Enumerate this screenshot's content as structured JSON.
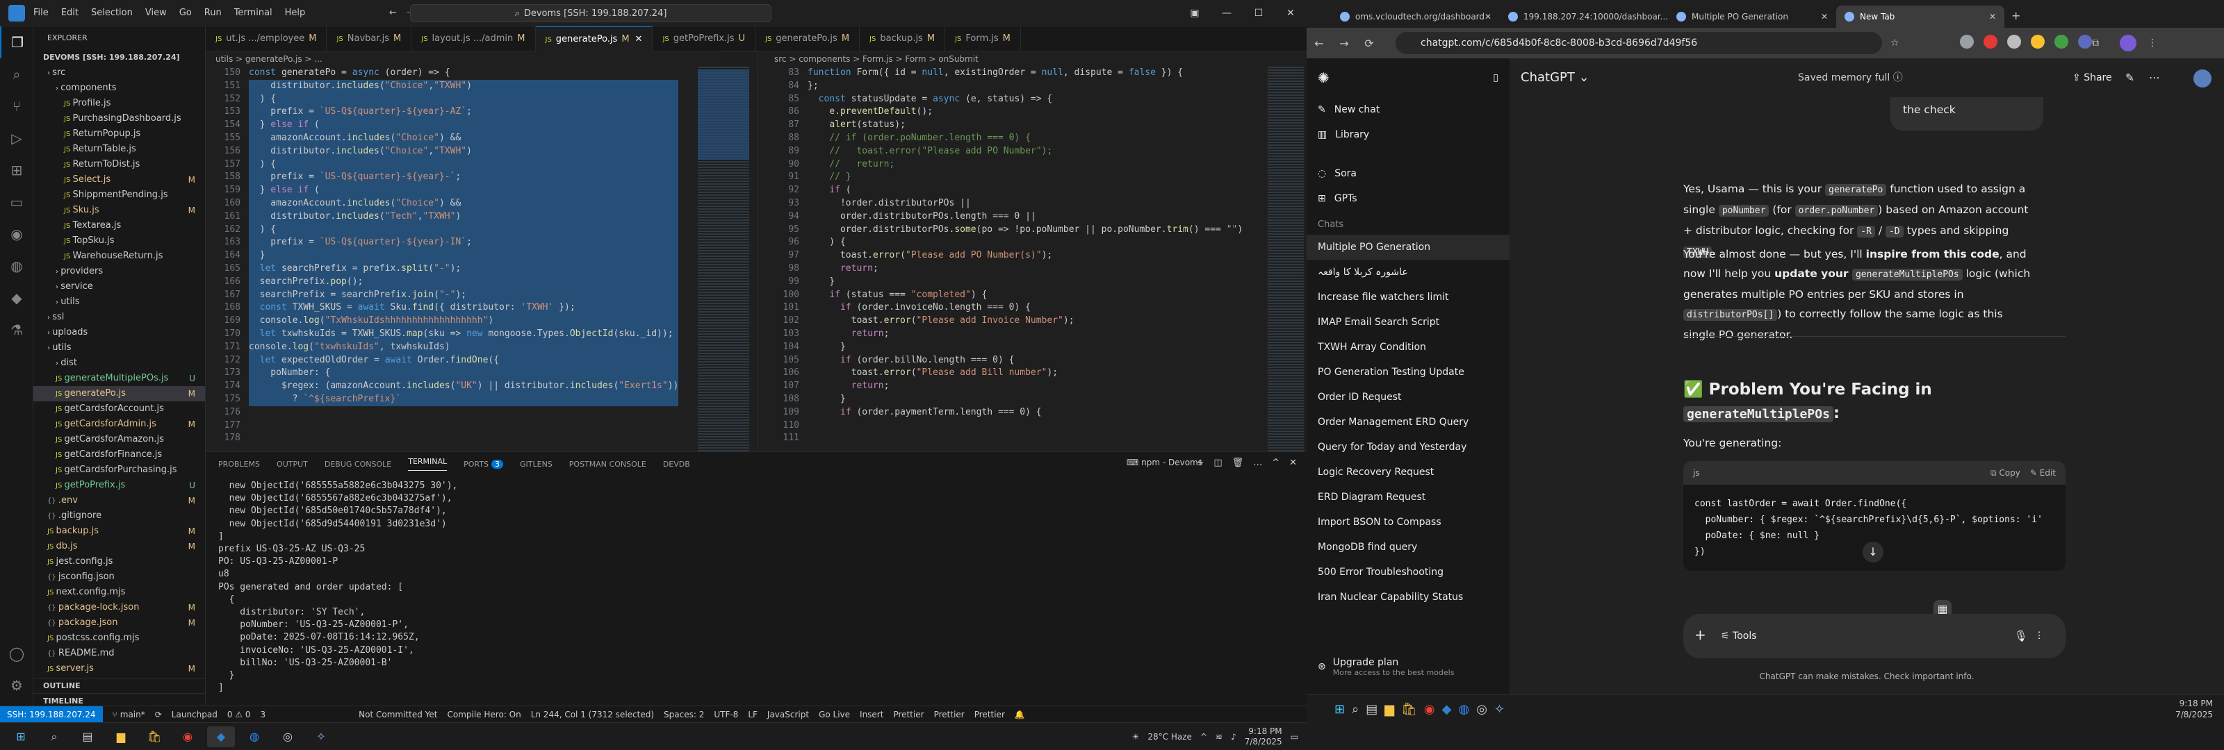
{
  "vscode": {
    "menu": [
      "File",
      "Edit",
      "Selection",
      "View",
      "Go",
      "Run",
      "Terminal",
      "Help"
    ],
    "command_center": "Devoms [SSH: 199.188.207.24]",
    "explorer_title": "EXPLORER",
    "root": "DEVOMS [SSH: 199.188.207.24]",
    "tree": [
      {
        "label": "src",
        "indent": 1,
        "kind": "folder",
        "mark": ""
      },
      {
        "label": "components",
        "indent": 2,
        "kind": "folder",
        "mark": ""
      },
      {
        "label": "Profile.js",
        "indent": 3,
        "kind": "js",
        "mark": ""
      },
      {
        "label": "PurchasingDashboard.js",
        "indent": 3,
        "kind": "js",
        "mark": ""
      },
      {
        "label": "ReturnPopup.js",
        "indent": 3,
        "kind": "js",
        "mark": ""
      },
      {
        "label": "ReturnTable.js",
        "indent": 3,
        "kind": "js",
        "mark": ""
      },
      {
        "label": "ReturnToDist.js",
        "indent": 3,
        "kind": "js",
        "mark": ""
      },
      {
        "label": "Select.js",
        "indent": 3,
        "kind": "js",
        "mark": "M"
      },
      {
        "label": "ShippmentPending.js",
        "indent": 3,
        "kind": "js",
        "mark": ""
      },
      {
        "label": "Sku.js",
        "indent": 3,
        "kind": "js",
        "mark": "M"
      },
      {
        "label": "Textarea.js",
        "indent": 3,
        "kind": "js",
        "mark": ""
      },
      {
        "label": "TopSku.js",
        "indent": 3,
        "kind": "js",
        "mark": ""
      },
      {
        "label": "WarehouseReturn.js",
        "indent": 3,
        "kind": "js",
        "mark": ""
      },
      {
        "label": "providers",
        "indent": 2,
        "kind": "folder",
        "mark": ""
      },
      {
        "label": "service",
        "indent": 2,
        "kind": "folder",
        "mark": ""
      },
      {
        "label": "utils",
        "indent": 2,
        "kind": "folder",
        "mark": ""
      },
      {
        "label": "ssl",
        "indent": 1,
        "kind": "folder",
        "mark": ""
      },
      {
        "label": "uploads",
        "indent": 1,
        "kind": "folder",
        "mark": ""
      },
      {
        "label": "utils",
        "indent": 1,
        "kind": "folder",
        "mark": ""
      },
      {
        "label": "dist",
        "indent": 2,
        "kind": "folder",
        "mark": ""
      },
      {
        "label": "generateMultiplePOs.js",
        "indent": 2,
        "kind": "js",
        "mark": "U"
      },
      {
        "label": "generatePo.js",
        "indent": 2,
        "kind": "js",
        "mark": "M"
      },
      {
        "label": "getCardsforAccount.js",
        "indent": 2,
        "kind": "js",
        "mark": ""
      },
      {
        "label": "getCardsforAdmin.js",
        "indent": 2,
        "kind": "js",
        "mark": "M"
      },
      {
        "label": "getCardsforAmazon.js",
        "indent": 2,
        "kind": "js",
        "mark": ""
      },
      {
        "label": "getCardsforFinance.js",
        "indent": 2,
        "kind": "js",
        "mark": ""
      },
      {
        "label": "getCardsforPurchasing.js",
        "indent": 2,
        "kind": "js",
        "mark": ""
      },
      {
        "label": "getPoPrefix.js",
        "indent": 2,
        "kind": "js",
        "mark": "U"
      },
      {
        "label": ".env",
        "indent": 1,
        "kind": "cfg",
        "mark": "M"
      },
      {
        "label": ".gitignore",
        "indent": 1,
        "kind": "cfg",
        "mark": ""
      },
      {
        "label": "backup.js",
        "indent": 1,
        "kind": "js",
        "mark": "M"
      },
      {
        "label": "db.js",
        "indent": 1,
        "kind": "js",
        "mark": "M"
      },
      {
        "label": "jest.config.js",
        "indent": 1,
        "kind": "js",
        "mark": ""
      },
      {
        "label": "jsconfig.json",
        "indent": 1,
        "kind": "cfg",
        "mark": ""
      },
      {
        "label": "next.config.mjs",
        "indent": 1,
        "kind": "js",
        "mark": ""
      },
      {
        "label": "package-lock.json",
        "indent": 1,
        "kind": "cfg",
        "mark": "M"
      },
      {
        "label": "package.json",
        "indent": 1,
        "kind": "cfg",
        "mark": "M"
      },
      {
        "label": "postcss.config.mjs",
        "indent": 1,
        "kind": "js",
        "mark": ""
      },
      {
        "label": "README.md",
        "indent": 1,
        "kind": "cfg",
        "mark": ""
      },
      {
        "label": "server.js",
        "indent": 1,
        "kind": "js",
        "mark": "M"
      }
    ],
    "outline": "OUTLINE",
    "timeline": "TIMELINE",
    "tabs": [
      {
        "label": "ut.js .../employee",
        "mark": "M",
        "active": false
      },
      {
        "label": "Navbar.js",
        "mark": "M",
        "active": false
      },
      {
        "label": "layout.js .../admin",
        "mark": "M",
        "active": false
      },
      {
        "label": "generatePo.js",
        "mark": "M",
        "active": true
      },
      {
        "label": "getPoPrefix.js",
        "mark": "U",
        "active": false
      },
      {
        "label": "generatePo.js",
        "mark": "M",
        "active": false
      },
      {
        "label": "backup.js",
        "mark": "M",
        "active": false
      },
      {
        "label": "Form.js",
        "mark": "M",
        "active": false
      }
    ],
    "left_breadcrumb": "utils > generatePo.js > ...",
    "right_breadcrumb": "src > components > Form.js > Form > onSubmit",
    "left_start_line": 150,
    "left_code": [
      "const generatePo = async (order) => {",
      "    distributor.includes(\"Choice\",\"TXWH\")",
      "  ) {",
      "    prefix = `US-Q${quarter}-${year}-AZ`;",
      "  } else if (",
      "    amazonAccount.includes(\"Choice\") &&",
      "    distributor.includes(\"Choice\",\"TXWH\")",
      "  ) {",
      "    prefix = `US-Q${quarter}-${year}-`;",
      "  } else if (",
      "    amazonAccount.includes(\"Choice\") &&",
      "    distributor.includes(\"Tech\",\"TXWH\")",
      "  ) {",
      "    prefix = `US-Q${quarter}-${year}-IN`;",
      "  }",
      "",
      "  let searchPrefix = prefix.split(\"-\");",
      "  searchPrefix.pop();",
      "  searchPrefix = searchPrefix.join(\"-\");",
      "",
      "  const TXWH_SKUS = await Sku.find({ distributor: 'TXWH' });",
      "  console.log(\"TxWhskuIdshhhhhhhhhhhhhhhhhh\")",
      "  let txwhskuIds = TXWH_SKUS.map(sku => new mongoose.Types.ObjectId(sku._id));",
      "",
      "console.log(\"txwhskuIds\", txwhskuIds)",
      "  let expectedOldOrder = await Order.findOne({",
      "    poNumber: {",
      "      $regex: (amazonAccount.includes(\"UK\") || distributor.includes(\"Exert1s\"))",
      "        ? `^${searchPrefix}`"
    ],
    "right_start_line": 83,
    "right_code": [
      "function Form({ id = null, existingOrder = null, dispute = false }) {",
      "};",
      "",
      "  const statusUpdate = async (e, status) => {",
      "    e.preventDefault();",
      "    alert(status);",
      "    // if (order.poNumber.length === 0) {",
      "    //   toast.error(\"Please add PO Number\");",
      "    //   return;",
      "    // }",
      "    if (",
      "      !order.distributorPOs ||",
      "      order.distributorPOs.length === 0 ||",
      "      order.distributorPOs.some(po => !po.poNumber || po.poNumber.trim() === \"\")",
      "    ) {",
      "      toast.error(\"Please add PO Number(s)\");",
      "      return;",
      "    }",
      "",
      "    if (status === \"completed\") {",
      "      if (order.invoiceNo.length === 0) {",
      "        toast.error(\"Please add Invoice Number\");",
      "        return;",
      "      }",
      "      if (order.billNo.length === 0) {",
      "        toast.error(\"Please add Bill number\");",
      "        return;",
      "      }",
      "      if (order.paymentTerm.length === 0) {"
    ],
    "panel_tabs": [
      "PROBLEMS",
      "OUTPUT",
      "DEBUG CONSOLE",
      "TERMINAL",
      "PORTS",
      "GITLENS",
      "POSTMAN CONSOLE",
      "DEVDB"
    ],
    "ports_badge": "3",
    "terminal_label": "npm - Devoms",
    "terminal": [
      "  new ObjectId('685555a5882e6c3b043275 30'),",
      "  new ObjectId('6855567a882e6c3b043275af'),",
      "  new ObjectId('685d50e01740c5b57a78df4'),",
      "  new ObjectId('685d9d54400191 3d0231e3d')",
      "]",
      "prefix US-Q3-25-AZ US-Q3-25",
      "PO: US-Q3-25-AZ00001-P",
      "u8",
      "POs generated and order updated: [",
      "  {",
      "    distributor: 'SY Tech',",
      "    poNumber: 'US-Q3-25-AZ00001-P',",
      "    poDate: 2025-07-08T16:14:12.965Z,",
      "    invoiceNo: 'US-Q3-25-AZ00001-I',",
      "    billNo: 'US-Q3-25-AZ00001-B'",
      "  }",
      "]"
    ],
    "status": {
      "remote": "SSH: 199.188.207.24",
      "branch": "main*",
      "launchpad": "Launchpad",
      "problems": "0 ⚠ 0",
      "ports": "3",
      "commit": "Not Committed Yet",
      "compile": "Compile Hero: On",
      "cursor": "Ln 244, Col 1 (7312 selected)",
      "spaces": "Spaces: 2",
      "encoding": "UTF-8",
      "eol": "LF",
      "lang": "JavaScript",
      "golive": "Go Live",
      "insert": "Insert",
      "prettier": "Prettier",
      "prettier2": "Prettier",
      "prettier3": "Prettier"
    }
  },
  "taskbar_left": {
    "weather": "28°C Haze",
    "time": "9:18 PM",
    "date": "7/8/2025"
  },
  "chrome": {
    "tabs": [
      {
        "label": "oms.vcloudtech.org/dashboard",
        "active": false
      },
      {
        "label": "199.188.207.24:10000/dashboar...",
        "active": false
      },
      {
        "label": "Multiple PO Generation",
        "active": false
      },
      {
        "label": "New Tab",
        "active": true
      }
    ],
    "url": "chatgpt.com/c/685d4b0f-8c8c-8008-b3cd-8696d7d49f56"
  },
  "chatgpt": {
    "model": "ChatGPT",
    "memory": "Saved memory full",
    "share": "Share",
    "nav": [
      {
        "label": "New chat",
        "icon": "pencil-icon"
      },
      {
        "label": "Library",
        "icon": "library-icon"
      },
      {
        "label": "Sora",
        "icon": "sora-icon"
      },
      {
        "label": "GPTs",
        "icon": "gpts-icon"
      }
    ],
    "chats_label": "Chats",
    "chats": [
      "Multiple PO Generation",
      "عاشورہ کربلا کا واقعہ",
      "Increase file watchers limit",
      "IMAP Email Search Script",
      "TXWH Array Condition",
      "PO Generation Testing Update",
      "Order ID Request",
      "Order Management ERD Query",
      "Query for Today and Yesterday",
      "Logic Recovery Request",
      "ERD Diagram Request",
      "Import BSON to Compass",
      "MongoDB find query",
      "500 Error Troubleshooting",
      "Iran Nuclear Capability Status"
    ],
    "upgrade_title": "Upgrade plan",
    "upgrade_sub": "More access to the best models",
    "user_bubble": "the check",
    "p1": {
      "a": "Yes, Usama — this is your ",
      "c1": "generatePo",
      "b": " function used to assign a single ",
      "c2": "poNumber",
      "c": " (for ",
      "c3": "order.poNumber",
      "d": ") based on Amazon account + distributor logic, checking for ",
      "c4": "-R",
      "e": " / ",
      "c5": "-D",
      "f": " types and skipping ",
      "c6": "TXWH",
      "g": "."
    },
    "p2": {
      "a": "You're almost done — but yes, I'll ",
      "b1": "inspire from this code",
      "b": ", and now I'll help you ",
      "b2": "update your ",
      "c1": "generateMultiplePOs",
      "c": " logic (which generates multiple PO entries per SKU and stores in ",
      "c2": "distributorPOs[]",
      "d": ") to correctly follow the same logic as this single PO generator."
    },
    "heading_emoji": "✅",
    "heading": "Problem You're Facing in",
    "heading_code": "generateMultiplePOs",
    "heading_end": ":",
    "generating": "You're generating:",
    "code_lang": "js",
    "copy": "Copy",
    "edit": "Edit",
    "code_lines": [
      "const lastOrder = await Order.findOne({",
      "  poNumber: { $regex: `^${searchPrefix}\\d{5,6}-P`, $options: 'i'",
      "  poDate: { $ne: null }",
      "})"
    ],
    "tools": "Tools",
    "footer": "ChatGPT can make mistakes. Check important info."
  },
  "taskbar_right": {
    "time": "9:18 PM",
    "date": "7/8/2025"
  }
}
